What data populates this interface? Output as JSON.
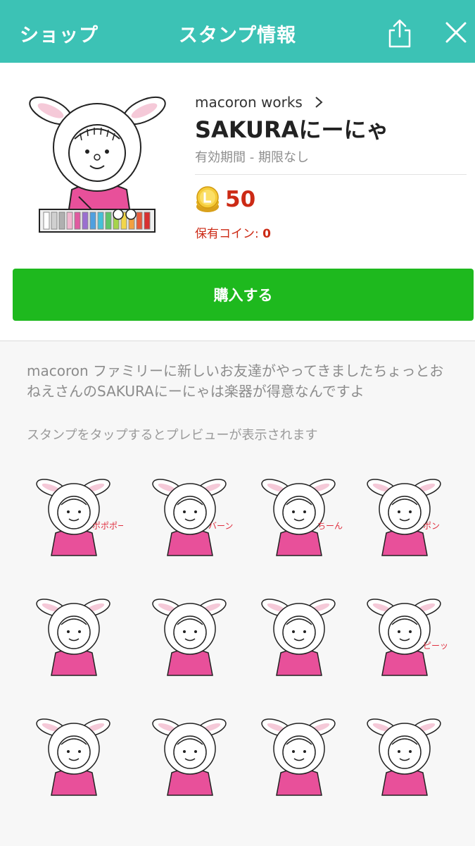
{
  "header": {
    "back_label": "ショップ",
    "title": "スタンプ情報",
    "share_icon": "share-icon",
    "close_icon": "close-icon"
  },
  "product": {
    "author": "macoron works",
    "title": "SAKURAにーにゃ",
    "validity": "有効期間 - 期限なし",
    "price": "50",
    "owned_label": "保有コイン:",
    "owned_value": "0",
    "buy_label": "購入する"
  },
  "description": "macoron ファミリーに新しいお友達がやってきましたちょっとおねえさんのSAKURAにーにゃは楽器が得意なんですよ",
  "hint": "スタンプをタップするとプレビューが表示されます",
  "stickers": [
    {
      "name": "sticker-xylophone",
      "annotation": "ポポポーン"
    },
    {
      "name": "sticker-keyboard-harmonica",
      "annotation": "バーン"
    },
    {
      "name": "sticker-triangle",
      "annotation": "ちーん"
    },
    {
      "name": "sticker-ocarina",
      "annotation": "ポン"
    },
    {
      "name": "sticker-tambourine",
      "annotation": ""
    },
    {
      "name": "sticker-maracas",
      "annotation": ""
    },
    {
      "name": "sticker-party-popper",
      "annotation": ""
    },
    {
      "name": "sticker-whistle",
      "annotation": "ピーッ"
    },
    {
      "name": "sticker-waving",
      "annotation": ""
    },
    {
      "name": "sticker-flute",
      "annotation": ""
    },
    {
      "name": "sticker-crying",
      "annotation": ""
    },
    {
      "name": "sticker-umbrella",
      "annotation": ""
    }
  ],
  "colors": {
    "header": "#3cc2b5",
    "buy_button": "#1eb91e",
    "price": "#cc2a15",
    "character_outfit": "#e8509a"
  }
}
